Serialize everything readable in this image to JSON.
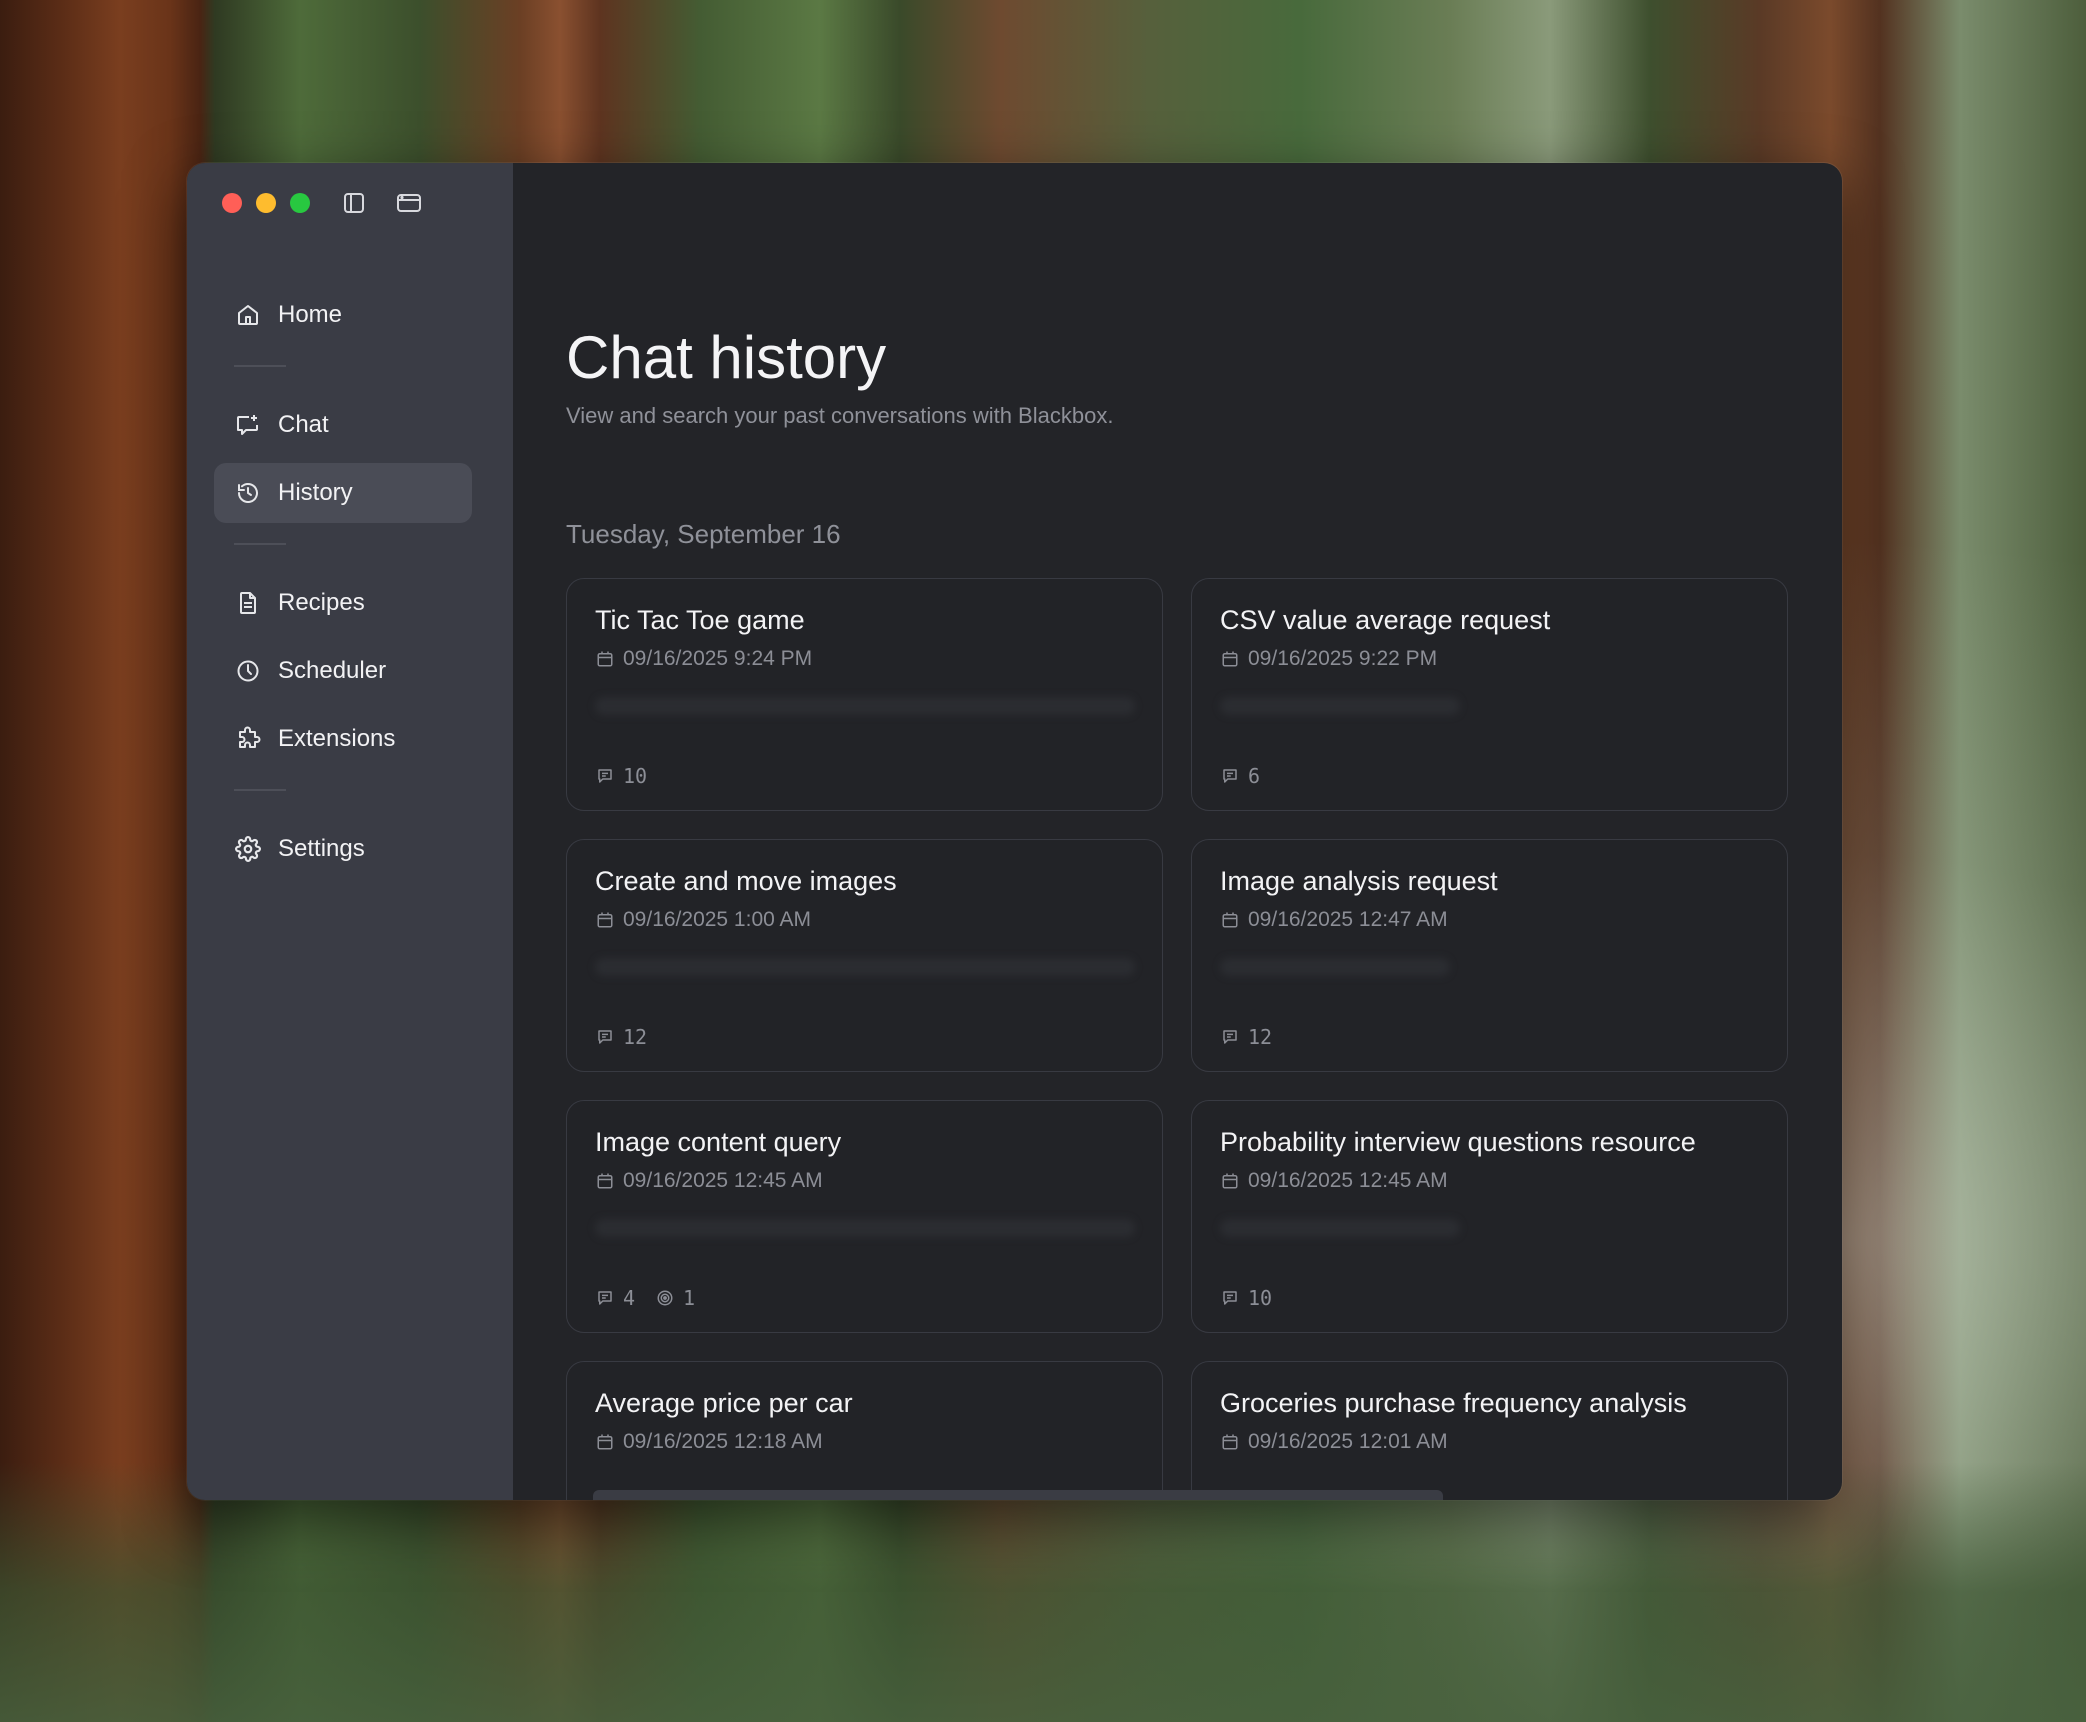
{
  "sidebar": {
    "items": [
      {
        "label": "Home",
        "icon": "home-icon"
      },
      {
        "label": "Chat",
        "icon": "chat-icon"
      },
      {
        "label": "History",
        "icon": "history-icon",
        "active": true
      },
      {
        "label": "Recipes",
        "icon": "document-icon"
      },
      {
        "label": "Scheduler",
        "icon": "clock-icon"
      },
      {
        "label": "Extensions",
        "icon": "puzzle-icon"
      },
      {
        "label": "Settings",
        "icon": "gear-icon"
      }
    ]
  },
  "main": {
    "title": "Chat history",
    "subtitle": "View and search your past conversations with Blackbox.",
    "date_heading": "Tuesday, September 16",
    "cards": [
      {
        "title": "Tic Tac Toe game",
        "date": "09/16/2025 9:24 PM",
        "messages": "10"
      },
      {
        "title": "CSV value average request",
        "date": "09/16/2025 9:22 PM",
        "messages": "6"
      },
      {
        "title": "Create and move images",
        "date": "09/16/2025 1:00 AM",
        "messages": "12"
      },
      {
        "title": "Image analysis request",
        "date": "09/16/2025 12:47 AM",
        "messages": "12"
      },
      {
        "title": "Image content query",
        "date": "09/16/2025 12:45 AM",
        "messages": "4",
        "tools": "1"
      },
      {
        "title": "Probability interview questions resource",
        "date": "09/16/2025 12:45 AM",
        "messages": "10"
      },
      {
        "title": "Average price per car",
        "date": "09/16/2025 12:18 AM"
      },
      {
        "title": "Groceries purchase frequency analysis",
        "date": "09/16/2025 12:01 AM"
      }
    ]
  },
  "colors": {
    "window_bg": "#232428",
    "sidebar_bg": "#3a3c45",
    "active_item_bg": "#4a4c56",
    "traffic_red": "#ff5f57",
    "traffic_yellow": "#febc2e",
    "traffic_green": "#28c840"
  }
}
